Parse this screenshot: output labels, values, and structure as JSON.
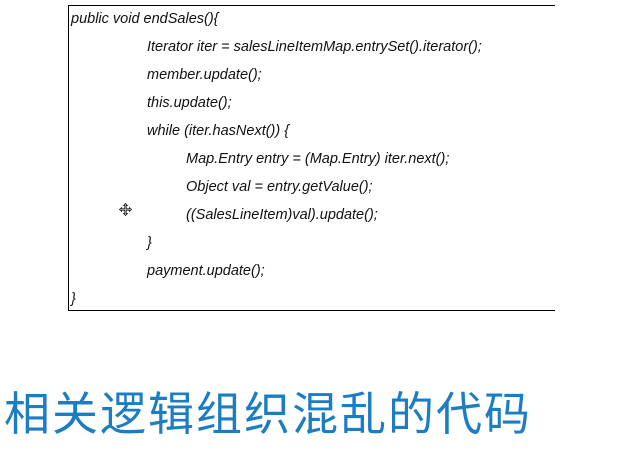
{
  "code": {
    "lines": [
      "public void endSales(){",
      "Iterator iter = salesLineItemMap.entrySet().iterator();",
      "member.update();",
      "this.update();",
      "while (iter.hasNext()) {",
      "Map.Entry entry = (Map.Entry) iter.next();",
      "Object val = entry.getValue();",
      "((SalesLineItem)val).update();",
      "}",
      "payment.update();",
      "}"
    ]
  },
  "cursor": {
    "icon": "move-cursor-icon"
  },
  "caption": {
    "text": "相关逻辑组织混乱的代码",
    "color": "#1d7dc2"
  }
}
